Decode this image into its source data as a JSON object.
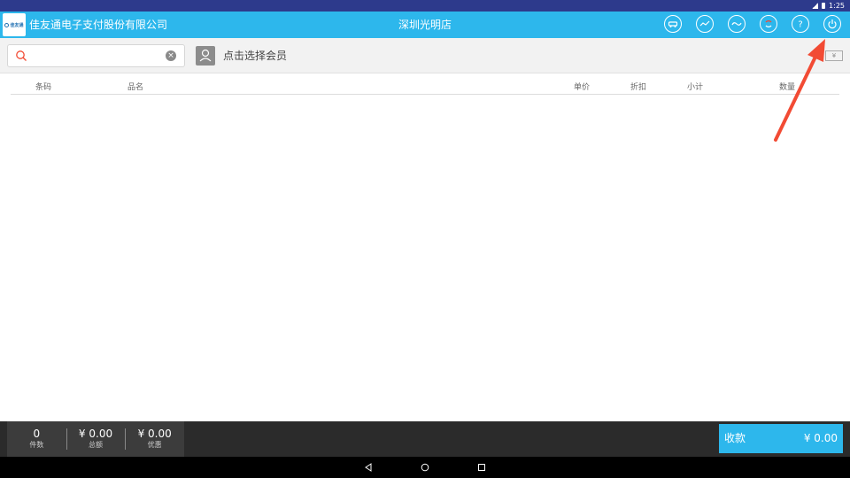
{
  "statusbar": {
    "time": "1:25"
  },
  "appbar": {
    "logo_text": "佳友通",
    "company": "佳友通电子支付股份有限公司",
    "store": "深圳光明店",
    "icons": [
      "car-icon",
      "trend-icon",
      "wave-icon",
      "sync-icon",
      "help-icon",
      "power-icon"
    ]
  },
  "search": {
    "value": "",
    "placeholder": ""
  },
  "member": {
    "label": "点击选择会员"
  },
  "price_tag": "¥",
  "table": {
    "columns": [
      "条码",
      "品名",
      "单价",
      "折扣",
      "小计",
      "数量"
    ],
    "rows": []
  },
  "summary": [
    {
      "value": "0",
      "label": "件数"
    },
    {
      "value": "¥ 0.00",
      "label": "总额"
    },
    {
      "value": "¥ 0.00",
      "label": "优惠"
    }
  ],
  "pay": {
    "label": "收款",
    "amount": "¥ 0.00"
  },
  "colors": {
    "accent": "#2db7ec",
    "arrow": "#f24b34",
    "bottom": "#2b2b2b"
  }
}
